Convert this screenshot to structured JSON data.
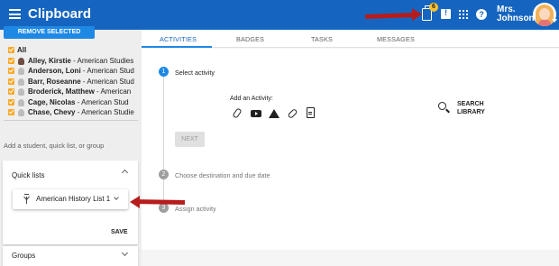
{
  "app": {
    "title": "Clipboard"
  },
  "header": {
    "notification_count": "6",
    "help_glyph": "?",
    "user_name_line1": "Mrs.",
    "user_name_line2": "Johnson"
  },
  "left_panel": {
    "remove_selected_label": "REMOVE SELECTED",
    "all_label": "All",
    "students": [
      {
        "name": "Alley, Kirstie",
        "class": " - American Studies"
      },
      {
        "name": "Anderson, Loni",
        "class": " - American Stud"
      },
      {
        "name": "Barr, Roseanne",
        "class": " - American Stud"
      },
      {
        "name": "Broderick, Matthew",
        "class": " - American"
      },
      {
        "name": "Cage, Nicolas",
        "class": " - American Stud"
      },
      {
        "name": "Chase, Chevy",
        "class": " - American Studie"
      }
    ],
    "add_placeholder": "Add a student, quick list, or group",
    "quick_lists": {
      "title": "Quick lists",
      "selected": "American History List 1",
      "save_label": "SAVE"
    },
    "groups": {
      "title": "Groups"
    }
  },
  "tabs": [
    "ACTIVITIES",
    "BADGES",
    "TASKS",
    "MESSAGES"
  ],
  "steps": {
    "step1": {
      "number": "1",
      "label": "Select activity"
    },
    "step2": {
      "number": "2",
      "label": "Choose destination and due date"
    },
    "step3": {
      "number": "3",
      "label": "Assign activity"
    },
    "add_activity_label": "Add an Activity:",
    "activity_icons": [
      "attachment-icon",
      "youtube-icon",
      "google-drive-icon",
      "link-icon",
      "document-icon"
    ],
    "search_library_line1": "SEARCH",
    "search_library_line2": "LIBRARY",
    "next_label": "NEXT"
  },
  "colors": {
    "topbar": "#1565c0",
    "accent": "#1e88e5",
    "checkbox": "#f9a825",
    "annotation_arrow": "#b71c1c",
    "badge": "#fbc02d"
  }
}
